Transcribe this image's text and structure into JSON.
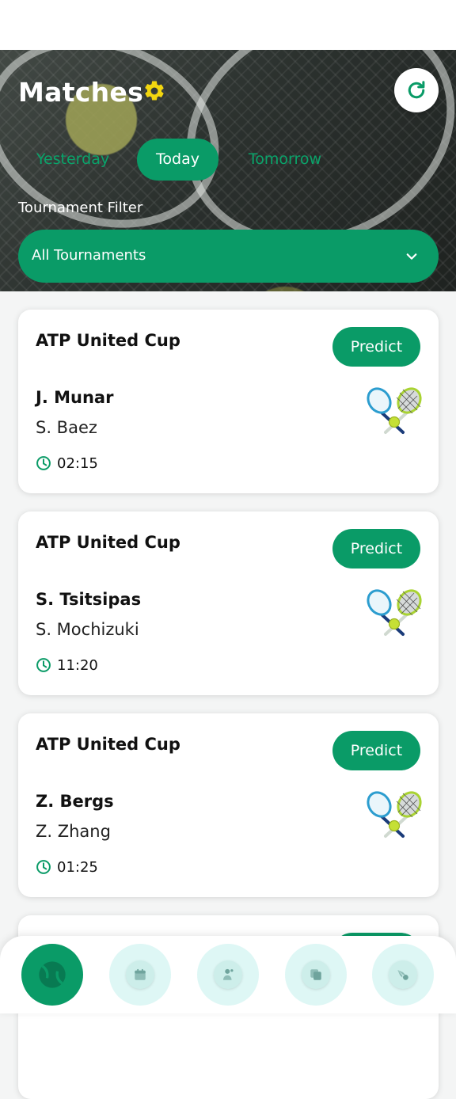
{
  "header": {
    "title": "Matches",
    "tabs": [
      {
        "label": "Yesterday",
        "active": false
      },
      {
        "label": "Today",
        "active": true
      },
      {
        "label": "Tomorrow",
        "active": false
      }
    ],
    "filter_label": "Tournament Filter",
    "filter_value": "All Tournaments"
  },
  "matches": [
    {
      "tournament": "ATP United Cup",
      "player1": "J. Munar",
      "player2": "S. Baez",
      "time": "02:15",
      "button": "Predict"
    },
    {
      "tournament": "ATP United Cup",
      "player1": "S. Tsitsipas",
      "player2": "S. Mochizuki",
      "time": "11:20",
      "button": "Predict"
    },
    {
      "tournament": "ATP United Cup",
      "player1": "Z. Bergs",
      "player2": "Z. Zhang",
      "time": "01:25",
      "button": "Predict"
    }
  ],
  "nav": {
    "items": [
      {
        "icon": "tennis-ball-icon",
        "active": true
      },
      {
        "icon": "calendar-icon",
        "active": false
      },
      {
        "icon": "player-icon",
        "active": false
      },
      {
        "icon": "cards-icon",
        "active": false
      },
      {
        "icon": "shuttle-icon",
        "active": false
      }
    ]
  },
  "colors": {
    "accent": "#0a9b67",
    "gear": "#f2d60f",
    "nav_bg": "#def7f5"
  }
}
